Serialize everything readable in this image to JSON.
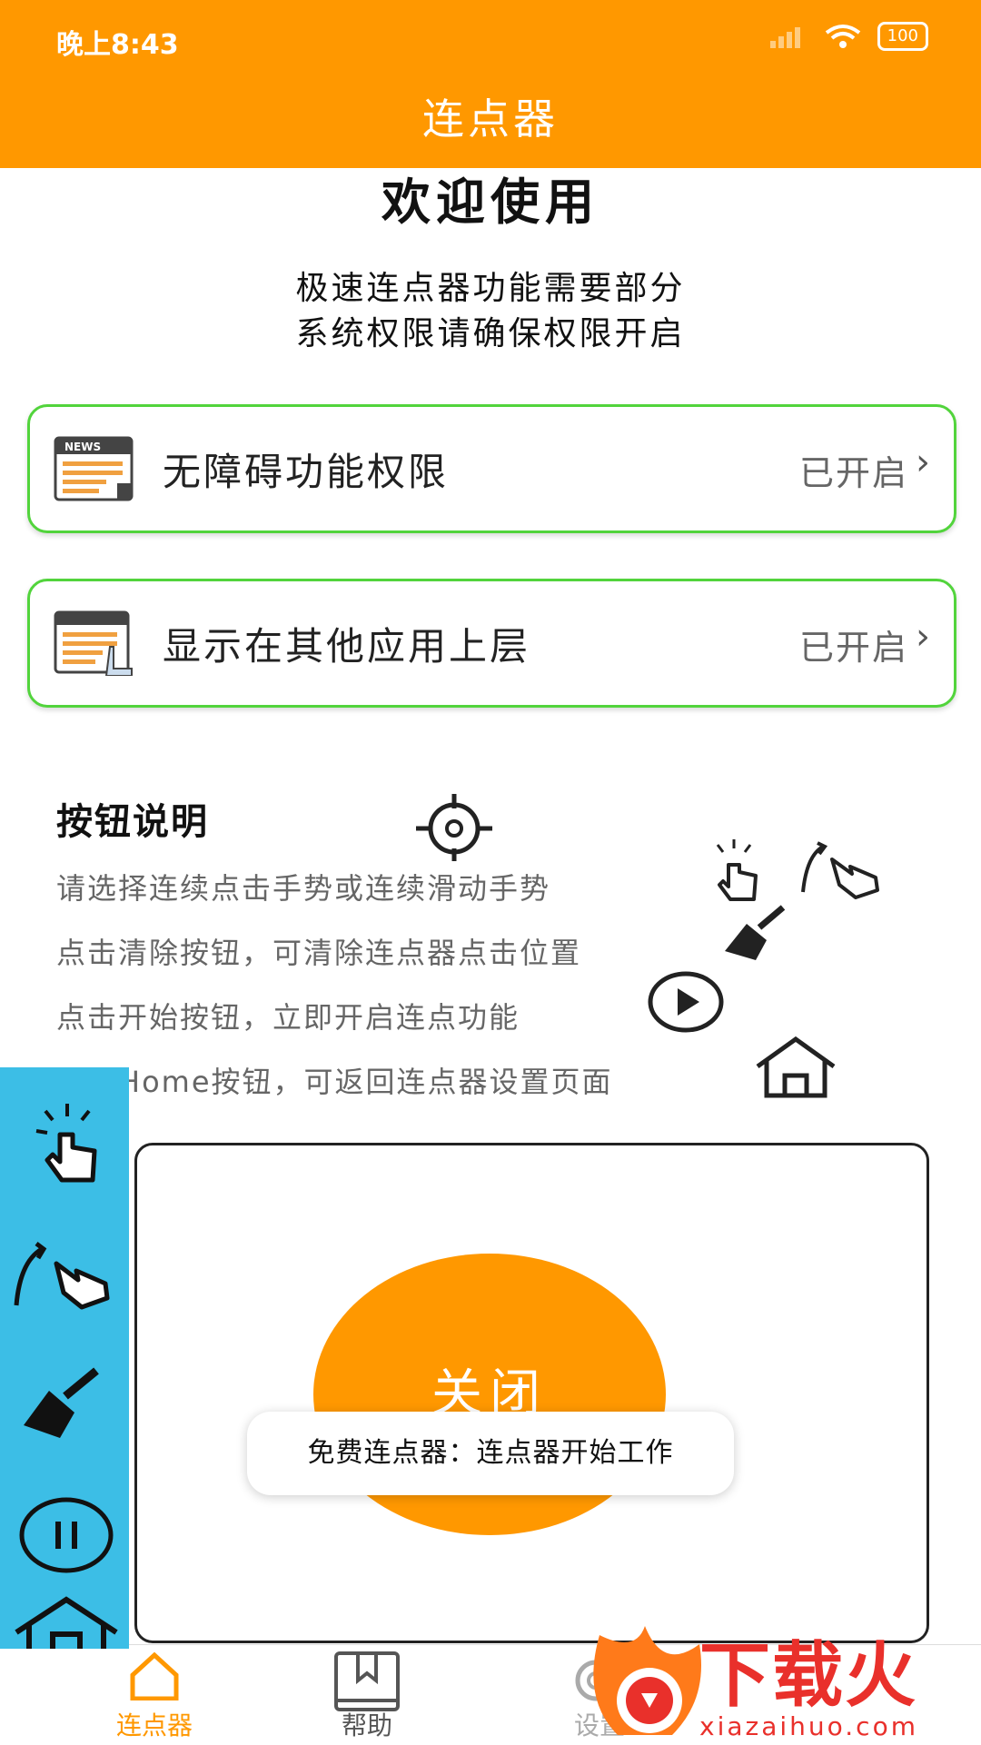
{
  "status_bar": {
    "time": "晚上8:43",
    "battery": "100"
  },
  "app_bar": {
    "title": "连点器"
  },
  "welcome": {
    "title": "欢迎使用",
    "line1": "极速连点器功能需要部分",
    "line2": "系统权限请确保权限开启"
  },
  "permissions": [
    {
      "label": "无障碍功能权限",
      "status": "已开启",
      "icon": "news-icon"
    },
    {
      "label": "显示在其他应用上层",
      "status": "已开启",
      "icon": "window-touch-icon"
    }
  ],
  "button_info": {
    "title": "按钮说明",
    "lines": [
      "请选择连续点击手势或连续滑动手势",
      "点击清除按钮，可清除连点器点击位置",
      "点击开始按钮，立即开启连点功能",
      "点击Home按钮，可返回连点器设置页面"
    ]
  },
  "main": {
    "close_button": "关闭"
  },
  "toast": {
    "text": "免费连点器：连点器开始工作"
  },
  "bottom_nav": [
    {
      "label": "连点器",
      "icon": "home-cursor-icon"
    },
    {
      "label": "帮助",
      "icon": "book-icon"
    },
    {
      "label": "设置",
      "icon": "gear-icon"
    }
  ],
  "watermark": {
    "brand": "下载火",
    "url": "xiazaihuo.com"
  },
  "colors": {
    "primary": "#FF9800",
    "card_border": "#52D43C",
    "float_panel": "#3CBEE6"
  }
}
